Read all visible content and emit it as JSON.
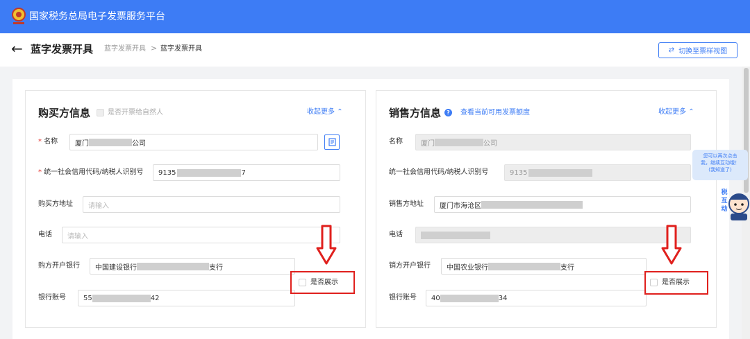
{
  "app": {
    "title": "国家税务总局电子发票服务平台"
  },
  "header": {
    "page_title": "蓝字发票开具",
    "breadcrumb": [
      "蓝字发票开具",
      "蓝字发票开具"
    ],
    "breadcrumb_sep": ">",
    "switch_view_label": "切换至票样视图"
  },
  "buyer": {
    "title": "购买方信息",
    "natural_person_label": "是否开票给自然人",
    "collapse_label": "收起更多",
    "name_label": "名称",
    "name_prefix": "厦门",
    "name_suffix": "公司",
    "tax_id_label": "统一社会信用代码/纳税人识别号",
    "tax_id_prefix": "9135",
    "tax_id_suffix": "7",
    "address_label": "购买方地址",
    "address_placeholder": "请输入",
    "phone_label": "电话",
    "phone_placeholder": "请输入",
    "bank_label": "购方开户银行",
    "bank_prefix": "中国建设银行",
    "bank_suffix": "支行",
    "account_label": "银行账号",
    "account_prefix": "55",
    "account_suffix": "42",
    "show_label": "是否展示"
  },
  "seller": {
    "title": "销售方信息",
    "quota_link": "查看当前可用发票额度",
    "collapse_label": "收起更多",
    "name_label": "名称",
    "name_prefix": "厦门",
    "name_suffix": "公司",
    "tax_id_label": "统一社会信用代码/纳税人识别号",
    "tax_id_prefix": "9135",
    "address_label": "销售方地址",
    "address_prefix": "厦门市海沧区",
    "phone_label": "电话",
    "bank_label": "销方开户银行",
    "bank_prefix": "中国农业银行",
    "bank_suffix": "支行",
    "account_label": "银行账号",
    "account_prefix": "40",
    "account_suffix": "34",
    "show_label": "是否展示"
  },
  "assistant": {
    "tip_line1": "您可以再次点击",
    "tip_line2": "我，继续互动哦！",
    "tip_line3": "(我知道了)",
    "mascot_label": "税互动"
  },
  "colors": {
    "brand": "#3d7cf5",
    "required": "#e5322d",
    "annotation": "#e0201d"
  },
  "icons": {
    "back": "arrow-left-icon",
    "switch": "swap-icon",
    "collapse": "chevron-up-icon",
    "help": "question-icon",
    "picker": "document-icon"
  }
}
